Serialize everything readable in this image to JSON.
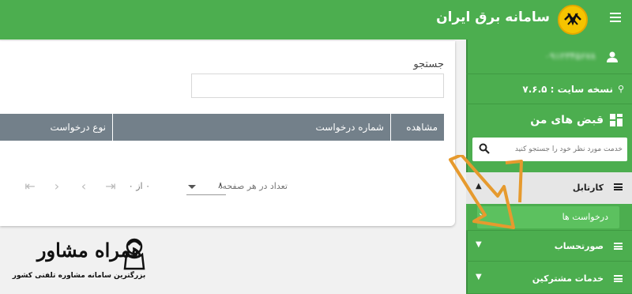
{
  "header": {
    "app_title": "سامانه برق ایران",
    "menu_icon": "hamburger-icon",
    "logo_icon": "tavanir-logo-icon",
    "bg_color": "#4cae4f"
  },
  "search": {
    "label": "جستجو",
    "value": ""
  },
  "table": {
    "columns": [
      "مشاهده",
      "شماره درخواست",
      "نوع درخواست"
    ],
    "header_color": "#73808a"
  },
  "pagination": {
    "rows_per_page_label": "تعداد در هر صفحه:",
    "rows_per_page_value": "۸",
    "range_text": "۰ از ۰"
  },
  "sidebar": {
    "user_name": "۰۹۱۲۳۴۵۶۷۸",
    "version_text": "نسخه سایت : ۷.۶.۵",
    "section_title": "قبض های من",
    "search_placeholder": "خدمت مورد نظر خود را جستجو کنید",
    "menu": {
      "cartable_label": "کارتابل",
      "requests_label": "درخواست ها",
      "bill_label": "صورتحساب",
      "services_label": "خدمات مشترکین"
    },
    "accent_color": "#4cae4f"
  },
  "watermark": {
    "brand_text": "همراه مشاور",
    "tagline": "بزرگترین سامانه مشاوره تلفنی کشور"
  }
}
